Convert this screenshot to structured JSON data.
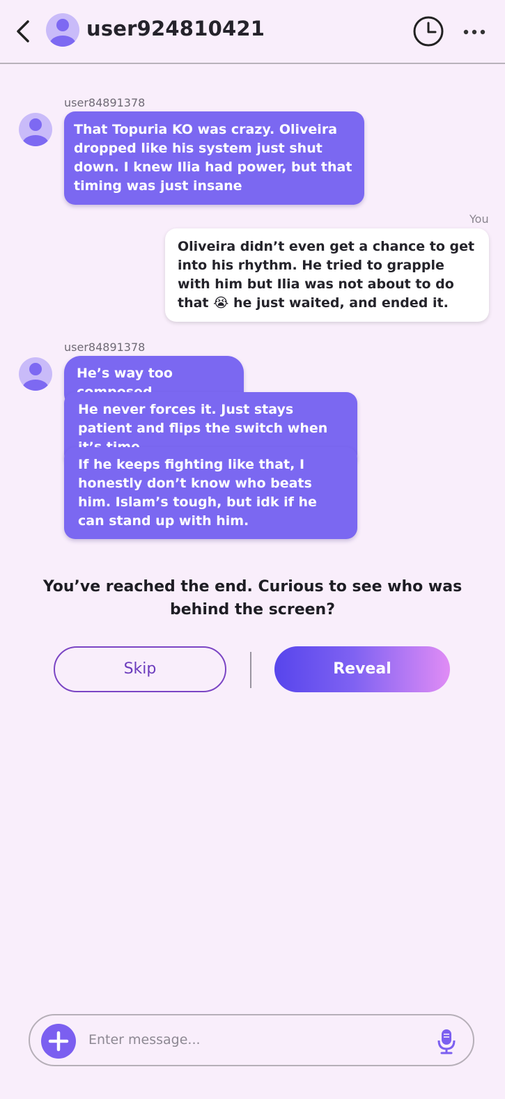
{
  "header": {
    "title": "user924810421",
    "icons": [
      "back-arrow-icon",
      "avatar",
      "clock-icon",
      "more-icon"
    ]
  },
  "messages": [
    {
      "sender": "user84891378",
      "bubbles": [
        "That Topuria KO was crazy. Oliveira dropped like his system just shut down. I knew Ilia had power, but that timing was just insane"
      ]
    },
    {
      "sender": "You",
      "bubbles": [
        "Oliveira didn’t even get a chance to get into his rhythm. He tried to grapple with him but Ilia was not about to do that 😭 he just waited, and ended it."
      ]
    },
    {
      "sender": "user84891378",
      "bubbles": [
        "He’s way too composed",
        "He never forces it. Just stays patient and flips the switch when it’s time.",
        "If he keeps fighting like that, I honestly don’t know who beats him. Islam’s tough, but idk if he can stand up with him."
      ]
    }
  ],
  "end": {
    "text": "You’ve reached the end. Curious to see who was behind the screen?",
    "skip_label": "Skip",
    "reveal_label": "Reveal"
  },
  "composer": {
    "placeholder": "Enter message..."
  },
  "colors": {
    "background": "#f9eefb",
    "bubble_them": "#7b68f1",
    "bubble_mine": "#ffffff",
    "accent": "#7b5ff0"
  }
}
